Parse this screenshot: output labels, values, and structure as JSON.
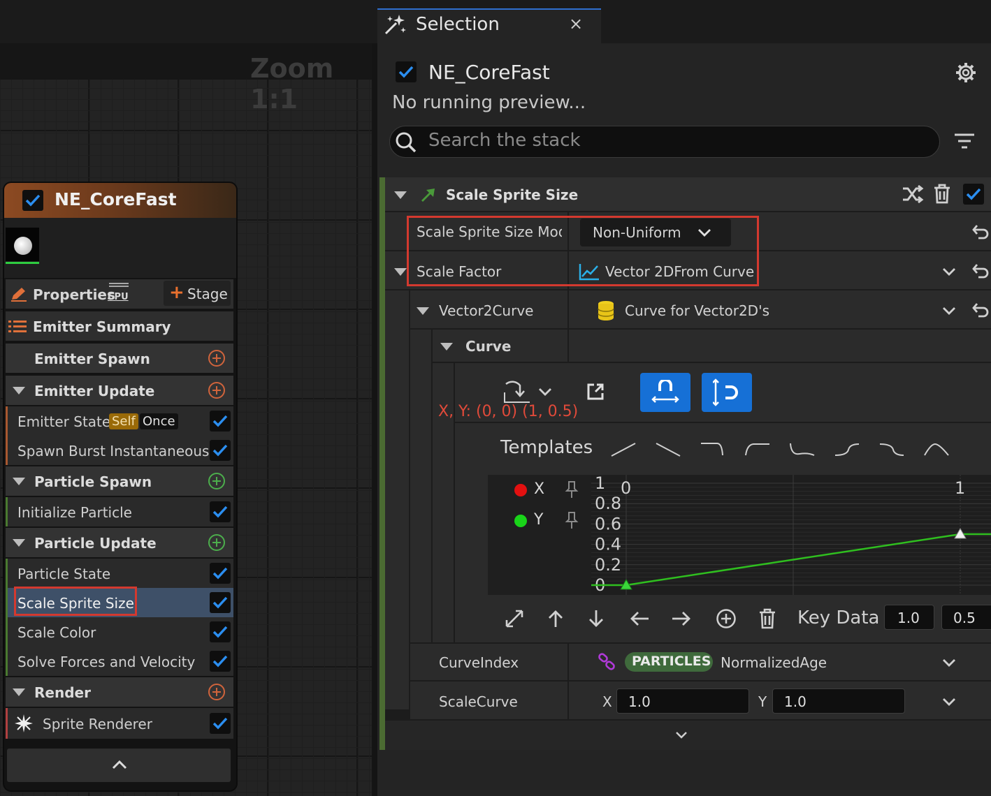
{
  "graph": {
    "zoom_label": "Zoom 1:1"
  },
  "node": {
    "title": "NE_CoreFast",
    "properties_label": "Properties",
    "cpu_label": "CPU",
    "stage_label": "Stage",
    "emitter_summary": "Emitter Summary",
    "emitter_spawn": "Emitter Spawn",
    "emitter_update": "Emitter Update",
    "emitter_state": "Emitter State",
    "badge_self": "Self",
    "badge_once": "Once",
    "spawn_burst": "Spawn Burst Instantaneous",
    "particle_spawn": "Particle Spawn",
    "initialize_particle": "Initialize Particle",
    "particle_update": "Particle Update",
    "particle_state": "Particle State",
    "scale_sprite_size": "Scale Sprite Size",
    "scale_color": "Scale Color",
    "solve_forces": "Solve Forces and Velocity",
    "render": "Render",
    "sprite_renderer": "Sprite Renderer"
  },
  "tab": {
    "title": "Selection",
    "close": "×"
  },
  "selection": {
    "system_name": "NE_CoreFast",
    "status": "No running preview...",
    "search_placeholder": "Search the stack"
  },
  "module": {
    "title": "Scale Sprite Size",
    "mode_label": "Scale Sprite Size Mod",
    "mode_value": "Non-Uniform",
    "scale_factor_label": "Scale Factor",
    "scale_factor_value": "Vector 2DFrom Curve",
    "vector2curve_label": "Vector2Curve",
    "vector2curve_value": "Curve for Vector2D's",
    "curve_label": "Curve",
    "coord_readout": "X, Y: (0, 0) (1, 0.5)",
    "templates_label": "Templates",
    "channels": [
      {
        "name": "X",
        "color": "#e31010"
      },
      {
        "name": "Y",
        "color": "#19d419"
      }
    ],
    "y_ticks": [
      "1",
      "0.8",
      "0.6",
      "0.4",
      "0.2",
      "0"
    ],
    "x_ticks": [
      "0",
      "1"
    ],
    "key_data_label": "Key Data",
    "key_data_values": [
      "1.0",
      "0.5"
    ],
    "curve_index_label": "CurveIndex",
    "particles_badge": "PARTICLES",
    "curve_index_value": "NormalizedAge",
    "scale_curve_label": "ScaleCurve",
    "scale_curve_x_label": "X",
    "scale_curve_x": "1.0",
    "scale_curve_y_label": "Y",
    "scale_curve_y": "1.0"
  },
  "curve_data": {
    "x_range": [
      0,
      1
    ],
    "y_range": [
      0,
      1
    ],
    "keys": [
      {
        "x": 0,
        "y": 0
      },
      {
        "x": 1,
        "y": 0.5
      }
    ],
    "curve_color": "#2fbf1f"
  }
}
